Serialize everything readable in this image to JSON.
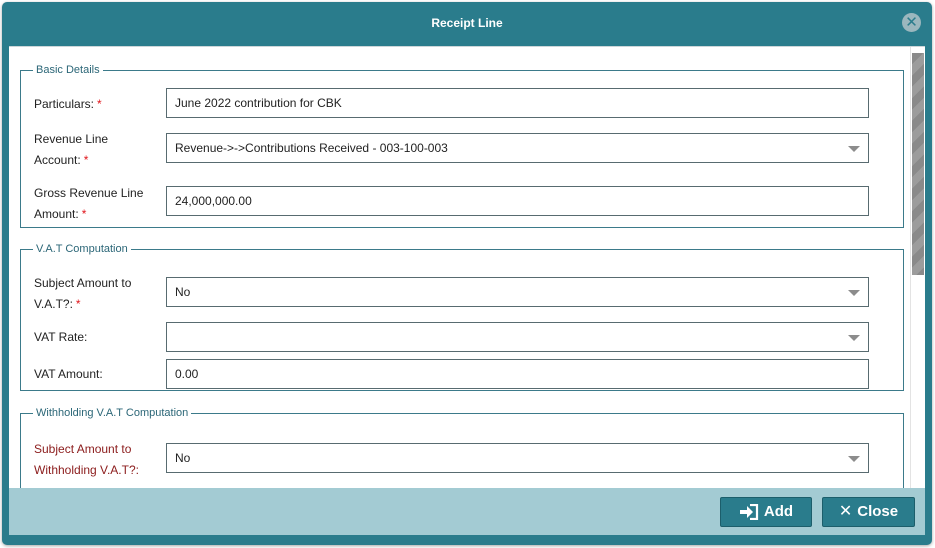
{
  "dialog": {
    "title": "Receipt Line",
    "close_icon": "close-circle-icon"
  },
  "basic": {
    "legend": "Basic Details",
    "particulars_label": "Particulars:",
    "particulars_value": "June 2022 contribution for CBK",
    "revenue_label_1": "Revenue Line",
    "revenue_label_2": "Account:",
    "revenue_value": "Revenue->->Contributions Received - 003-100-003",
    "gross_label_1": "Gross Revenue Line",
    "gross_label_2": "Amount:",
    "gross_value": "24,000,000.00"
  },
  "vat": {
    "legend": "V.A.T Computation",
    "subject_label_1": "Subject Amount to",
    "subject_label_2": "V.A.T?:",
    "subject_value": "No",
    "rate_label": "VAT Rate:",
    "rate_value": "",
    "amount_label": "VAT Amount:",
    "amount_value": "0.00"
  },
  "wht": {
    "legend": "Withholding V.A.T Computation",
    "subject_label_1": "Subject Amount to",
    "subject_label_2": "Withholding V.A.T?:",
    "subject_value": "No"
  },
  "required_marker": "*",
  "footer": {
    "add_label": "Add",
    "add_icon": "sign-in-icon",
    "close_label": "Close",
    "close_icon": "times-icon"
  },
  "colors": {
    "primary": "#2a7c8c",
    "footer_bg": "#a3cbd3",
    "required": "#e0141a",
    "warning_label": "#8b1b1b"
  }
}
